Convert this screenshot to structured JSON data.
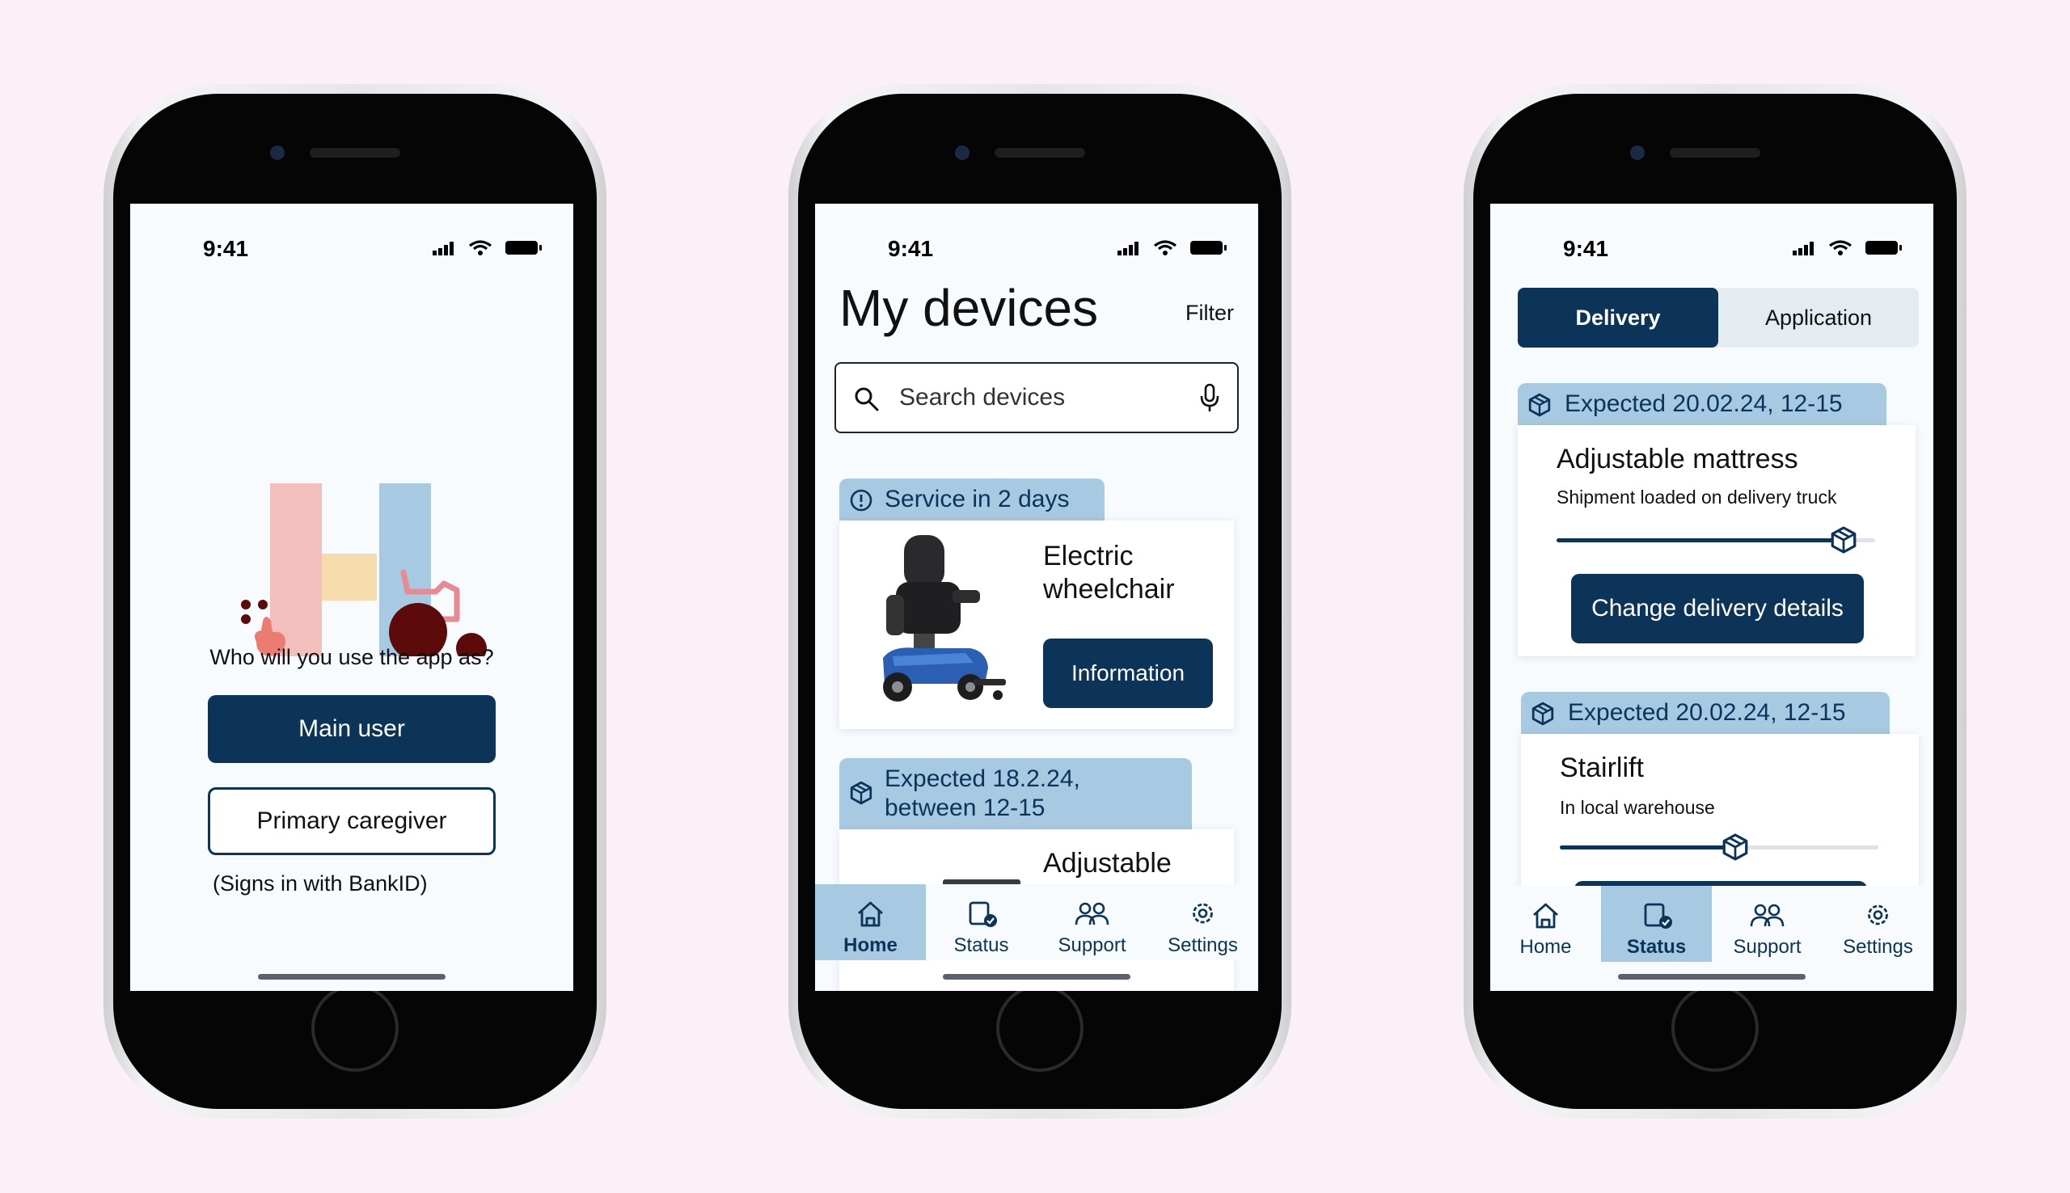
{
  "colors": {
    "background": "#fcf0f8",
    "primary": "#0c3458",
    "tag": "#a7c9e2",
    "screen": "#f7fbfe"
  },
  "phone1": {
    "time": "9:41",
    "prompt": "Who will you use the app as?",
    "main_user_label": "Main user",
    "caregiver_label": "Primary caregiver",
    "note": "(Signs in with BankID)"
  },
  "phone2": {
    "time": "9:41",
    "title": "My devices",
    "filter_label": "Filter",
    "search_placeholder": "Search devices",
    "service_tag": "Service in 2 days",
    "device1_name": "Electric wheelchair",
    "info_button": "Information",
    "expected_tag_line1": "Expected 18.2.24,",
    "expected_tag_line2": "between 12-15",
    "device2_name": "Adjustable",
    "tabs": [
      {
        "label": "Home",
        "icon": "home-icon",
        "active": true
      },
      {
        "label": "Status",
        "icon": "status-icon",
        "active": false
      },
      {
        "label": "Support",
        "icon": "support-icon",
        "active": false
      },
      {
        "label": "Settings",
        "icon": "settings-icon",
        "active": false
      }
    ]
  },
  "phone3": {
    "time": "9:41",
    "seg_delivery": "Delivery",
    "seg_application": "Application",
    "item1_tag": "Expected 20.02.24, 12-15",
    "item1_name": "Adjustable mattress",
    "item1_status": "Shipment loaded on delivery truck",
    "item1_progress": 0.9,
    "change_button": "Change delivery details",
    "item2_tag": "Expected 20.02.24, 12-15",
    "item2_name": "Stairlift",
    "item2_status": "In local warehouse",
    "item2_progress": 0.55,
    "tabs": [
      {
        "label": "Home",
        "icon": "home-icon",
        "active": false
      },
      {
        "label": "Status",
        "icon": "status-icon",
        "active": true
      },
      {
        "label": "Support",
        "icon": "support-icon",
        "active": false
      },
      {
        "label": "Settings",
        "icon": "settings-icon",
        "active": false
      }
    ]
  }
}
